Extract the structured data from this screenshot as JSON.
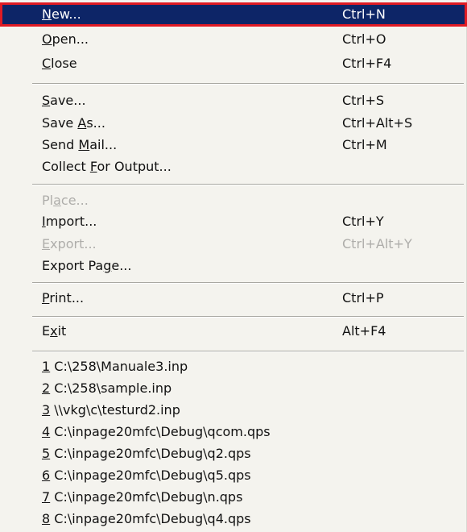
{
  "menu": {
    "items": [
      {
        "pre": "",
        "key": "N",
        "post": "ew...",
        "shortcut": "Ctrl+N"
      },
      {
        "pre": "",
        "key": "O",
        "post": "pen...",
        "shortcut": "Ctrl+O"
      },
      {
        "pre": "",
        "key": "C",
        "post": "lose",
        "shortcut": "Ctrl+F4"
      },
      {
        "pre": "",
        "key": "S",
        "post": "ave...",
        "shortcut": "Ctrl+S"
      },
      {
        "pre": "Save ",
        "key": "A",
        "post": "s...",
        "shortcut": "Ctrl+Alt+S"
      },
      {
        "pre": "Send ",
        "key": "M",
        "post": "ail...",
        "shortcut": "Ctrl+M"
      },
      {
        "pre": "Collect ",
        "key": "F",
        "post": "or Output...",
        "shortcut": ""
      },
      {
        "pre": "Pl",
        "key": "a",
        "post": "ce...",
        "shortcut": "",
        "disabled": true
      },
      {
        "pre": "",
        "key": "I",
        "post": "mport...",
        "shortcut": "Ctrl+Y"
      },
      {
        "pre": "",
        "key": "E",
        "post": "xport...",
        "shortcut": "Ctrl+Alt+Y",
        "disabled": true
      },
      {
        "pre": "Export Pa",
        "key": "g",
        "post": "e...",
        "shortcut": ""
      },
      {
        "pre": "",
        "key": "P",
        "post": "rint...",
        "shortcut": "Ctrl+P"
      },
      {
        "pre": "E",
        "key": "x",
        "post": "it",
        "shortcut": "Alt+F4"
      }
    ],
    "recent_files": [
      {
        "key": "1",
        "path": " C:\\258\\Manuale3.inp"
      },
      {
        "key": "2",
        "path": " C:\\258\\sample.inp"
      },
      {
        "key": "3",
        "path": " \\\\vkg\\c\\testurd2.inp"
      },
      {
        "key": "4",
        "path": " C:\\inpage20mfc\\Debug\\qcom.qps"
      },
      {
        "key": "5",
        "path": " C:\\inpage20mfc\\Debug\\q2.qps"
      },
      {
        "key": "6",
        "path": " C:\\inpage20mfc\\Debug\\q5.qps"
      },
      {
        "key": "7",
        "path": " C:\\inpage20mfc\\Debug\\n.qps"
      },
      {
        "key": "8",
        "path": " C:\\inpage20mfc\\Debug\\q4.qps"
      }
    ],
    "colors": {
      "highlight": "#0d2567",
      "highlight_border": "#e01b24",
      "background": "#f4f3ee",
      "disabled_text": "#aeadaa"
    }
  }
}
